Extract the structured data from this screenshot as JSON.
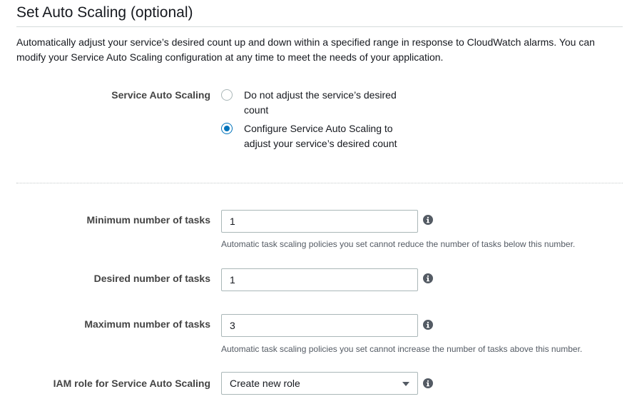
{
  "section": {
    "title": "Set Auto Scaling (optional)",
    "description": "Automatically adjust your service’s desired count up and down within a specified range in response to CloudWatch alarms. You can modify your Service Auto Scaling configuration at any time to meet the needs of your application."
  },
  "service_auto_scaling": {
    "label": "Service Auto Scaling",
    "options": [
      {
        "label": "Do not adjust the service’s desired count",
        "selected": false
      },
      {
        "label": "Configure Service Auto Scaling to adjust your service’s desired count",
        "selected": true
      }
    ]
  },
  "min_tasks": {
    "label": "Minimum number of tasks",
    "value": "1",
    "help": "Automatic task scaling policies you set cannot reduce the number of tasks below this number."
  },
  "desired_tasks": {
    "label": "Desired number of tasks",
    "value": "1"
  },
  "max_tasks": {
    "label": "Maximum number of tasks",
    "value": "3",
    "help": "Automatic task scaling policies you set cannot increase the number of tasks above this number."
  },
  "iam_role": {
    "label": "IAM role for Service Auto Scaling",
    "selected": "Create new role"
  },
  "icons": {
    "info": "info-icon",
    "dropdown": "chevron-down-icon"
  },
  "colors": {
    "accent": "#0073bb",
    "border": "#aab7b8",
    "help_text": "#545b64"
  }
}
